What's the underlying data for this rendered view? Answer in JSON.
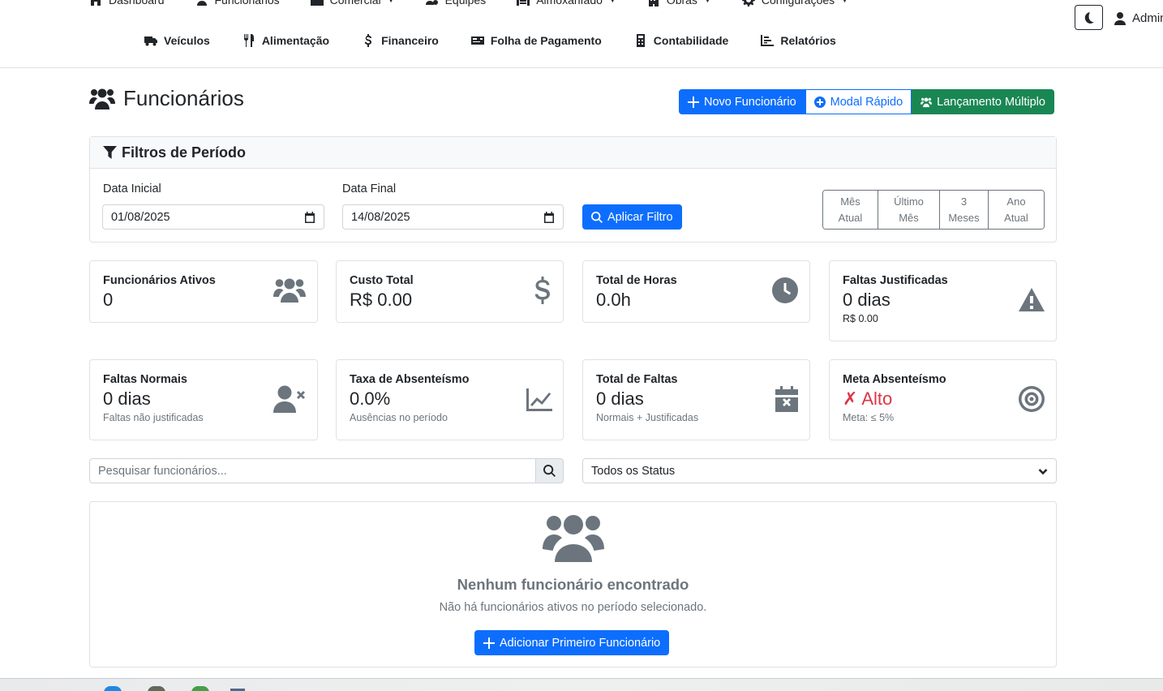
{
  "nav": {
    "row1": [
      {
        "label": "Dashboard",
        "icon": "home-icon"
      },
      {
        "label": "Funcionários",
        "icon": "users-icon"
      },
      {
        "label": "Comercial",
        "icon": "briefcase-icon",
        "dropdown": true
      },
      {
        "label": "Equipes",
        "icon": "team-cog-icon"
      },
      {
        "label": "Almoxarifado",
        "icon": "warehouse-icon",
        "dropdown": true
      },
      {
        "label": "Obras",
        "icon": "building-icon",
        "dropdown": true
      },
      {
        "label": "Configurações",
        "icon": "gear-icon",
        "dropdown": true
      }
    ],
    "row2": [
      {
        "label": "Veículos",
        "icon": "truck-icon"
      },
      {
        "label": "Alimentação",
        "icon": "utensils-icon"
      },
      {
        "label": "Financeiro",
        "icon": "dollar-icon"
      },
      {
        "label": "Folha de Pagamento",
        "icon": "money-check-icon"
      },
      {
        "label": "Contabilidade",
        "icon": "calculator-icon"
      },
      {
        "label": "Relatórios",
        "icon": "chart-bar-icon"
      }
    ],
    "user_label": "Admin"
  },
  "page": {
    "title": "Funcionários",
    "buttons": {
      "new_employee": "Novo Funcionário",
      "quick_modal": "Modal Rápido",
      "multi_entry": "Lançamento Múltiplo"
    }
  },
  "filters": {
    "header": "Filtros de Período",
    "start_label": "Data Inicial",
    "start_value": "01/08/2025",
    "end_label": "Data Final",
    "end_value": "14/08/2025",
    "apply_label": "Aplicar Filtro",
    "periods": [
      {
        "line1": "Mês",
        "line2": "Atual"
      },
      {
        "line1": "Último",
        "line2": "Mês"
      },
      {
        "line1": "3",
        "line2": "Meses"
      },
      {
        "line1": "Ano",
        "line2": "Atual"
      }
    ]
  },
  "stats": {
    "active": {
      "title": "Funcionários Ativos",
      "value": "0"
    },
    "cost": {
      "title": "Custo Total",
      "value": "R$ 0.00"
    },
    "hours": {
      "title": "Total de Horas",
      "value": "0.0h"
    },
    "justified": {
      "title": "Faltas Justificadas",
      "value": "0 dias",
      "sub": "R$ 0.00"
    },
    "normal": {
      "title": "Faltas Normais",
      "value": "0 dias",
      "sub": "Faltas não justificadas"
    },
    "absent_rate": {
      "title": "Taxa de Absenteísmo",
      "value": "0.0%",
      "sub": "Ausências no período"
    },
    "total_absences": {
      "title": "Total de Faltas",
      "value": "0 dias",
      "sub": "Normais + Justificadas"
    },
    "goal": {
      "title": "Meta Absenteísmo",
      "value": "✗ Alto",
      "sub": "Meta: ≤ 5%"
    }
  },
  "search": {
    "placeholder": "Pesquisar funcionários...",
    "status_value": "Todos os Status"
  },
  "empty": {
    "title": "Nenhum funcionário encontrado",
    "text": "Não há funcionários ativos no período selecionado.",
    "button": "Adicionar Primeiro Funcionário"
  },
  "colors": {
    "primary": "#0d6efd",
    "success": "#198754",
    "danger": "#dc3545",
    "muted": "#6c757d"
  }
}
